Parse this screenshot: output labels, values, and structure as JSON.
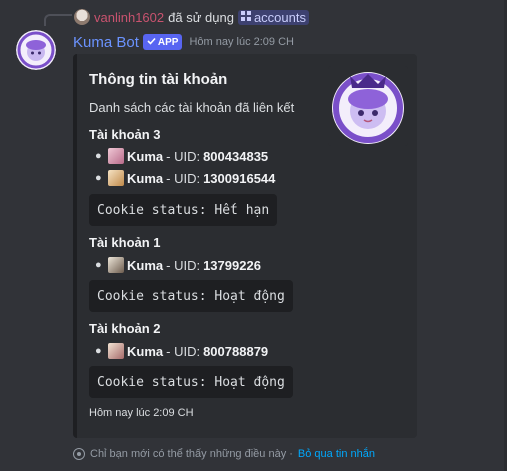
{
  "reply": {
    "username": "vanlinh1602",
    "action_text": "đã sử dụng",
    "command": "accounts",
    "command_icon": "slash-command-icon"
  },
  "message": {
    "author": "Kuma Bot",
    "badge": "APP",
    "badge_icon": "checkmark-icon",
    "timestamp": "Hôm nay lúc 2:09 CH"
  },
  "embed": {
    "title": "Thông tin tài khoản",
    "description": "Danh sách các tài khoản đã liên kết",
    "accounts": [
      {
        "heading": "Tài khoản 3",
        "characters": [
          {
            "name": "Kuma",
            "uid_label": "- UID:",
            "uid": "800434835",
            "icon": "honkai-character-icon"
          },
          {
            "name": "Kuma",
            "uid_label": "- UID:",
            "uid": "1300916544",
            "icon": "genshin-character-icon"
          }
        ],
        "cookie_status": "Cookie status: Hết hạn"
      },
      {
        "heading": "Tài khoản 1",
        "characters": [
          {
            "name": "Kuma",
            "uid_label": "- UID:",
            "uid": "13799226",
            "icon": "zzz-character-icon"
          }
        ],
        "cookie_status": "Cookie status: Hoạt động"
      },
      {
        "heading": "Tài khoản 2",
        "characters": [
          {
            "name": "Kuma",
            "uid_label": "- UID:",
            "uid": "800788879",
            "icon": "honkai-character-icon"
          }
        ],
        "cookie_status": "Cookie status: Hoạt động"
      }
    ],
    "footer": "Hôm nay lúc 2:09 CH"
  },
  "ephemeral": {
    "note": "Chỉ bạn mới có thể thấy những điều này ·",
    "dismiss": "Bỏ qua tin nhắn"
  },
  "colors": {
    "background": "#313338",
    "embed_bg": "#2b2d31",
    "bot_name": "#6b93ff",
    "app_badge": "#5865f2",
    "link": "#00a8fc",
    "reply_user": "#c9536f"
  }
}
